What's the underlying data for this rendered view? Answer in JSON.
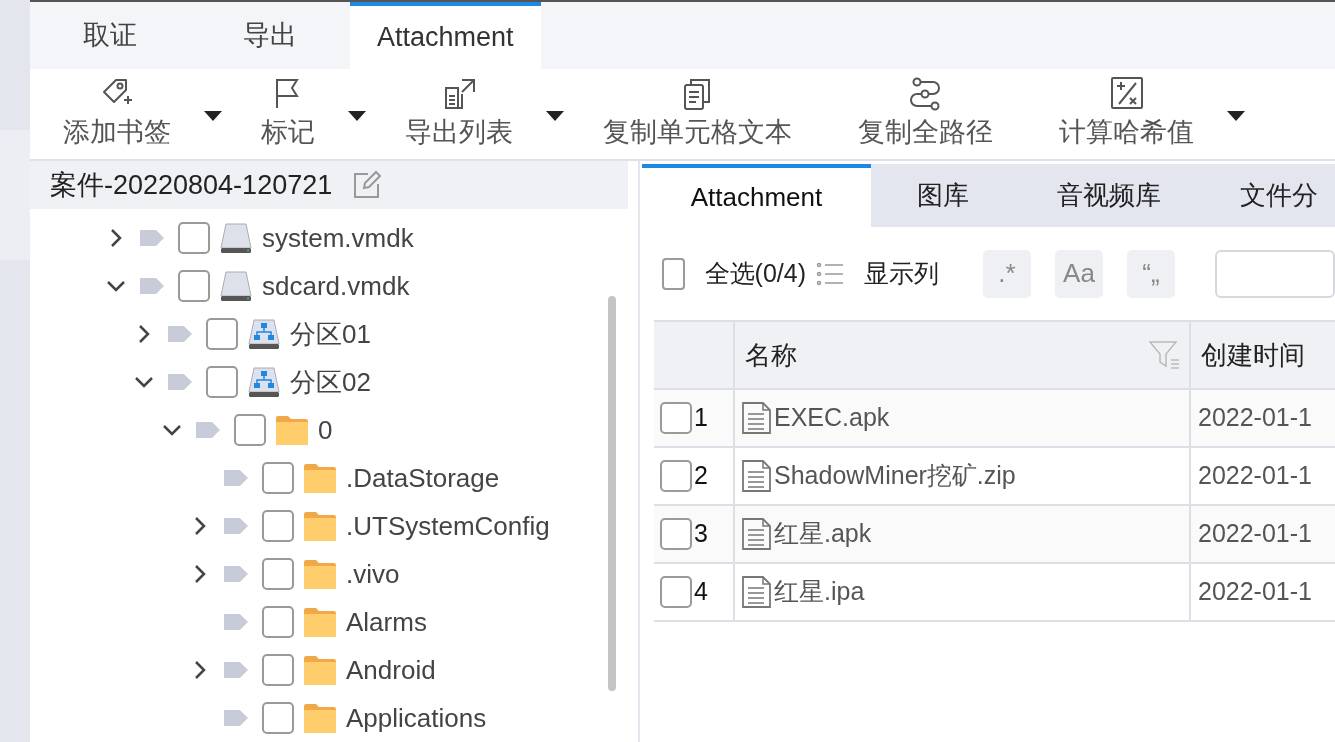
{
  "main_tabs": [
    {
      "label": "取证",
      "selected": false
    },
    {
      "label": "导出",
      "selected": false
    },
    {
      "label": "Attachment",
      "selected": true
    }
  ],
  "toolbar": [
    {
      "kind": "tag",
      "label": "添加书签",
      "dropdown": true
    },
    {
      "kind": "flag",
      "label": "标记",
      "dropdown": true
    },
    {
      "kind": "export",
      "label": "导出列表",
      "dropdown": true
    },
    {
      "kind": "copy",
      "label": "复制单元格文本",
      "dropdown": false
    },
    {
      "kind": "path",
      "label": "复制全路径",
      "dropdown": false
    },
    {
      "kind": "hash",
      "label": "计算哈希值",
      "dropdown": true
    }
  ],
  "case_title": "案件-20220804-120721",
  "tree": [
    {
      "label": "system.vmdk",
      "kind": "disk",
      "expandable": true,
      "expanded": false,
      "checked": false
    },
    {
      "label": "sdcard.vmdk",
      "kind": "disk",
      "expandable": true,
      "expanded": true,
      "checked": false,
      "children": [
        {
          "label": "分区01",
          "kind": "partition",
          "expandable": true,
          "expanded": false,
          "checked": false
        },
        {
          "label": "分区02",
          "kind": "partition",
          "expandable": true,
          "expanded": true,
          "checked": false,
          "children": [
            {
              "label": "0",
              "kind": "folder",
              "expandable": true,
              "expanded": true,
              "checked": false,
              "children": [
                {
                  "label": ".DataStorage",
                  "kind": "folder",
                  "expandable": false,
                  "checked": false
                },
                {
                  "label": ".UTSystemConfig",
                  "kind": "folder",
                  "expandable": true,
                  "expanded": false,
                  "checked": false
                },
                {
                  "label": ".vivo",
                  "kind": "folder",
                  "expandable": true,
                  "expanded": false,
                  "checked": false
                },
                {
                  "label": "Alarms",
                  "kind": "folder",
                  "expandable": false,
                  "checked": false
                },
                {
                  "label": "Android",
                  "kind": "folder",
                  "expandable": true,
                  "expanded": false,
                  "checked": false
                },
                {
                  "label": "Applications",
                  "kind": "folder",
                  "expandable": false,
                  "checked": false
                }
              ]
            }
          ]
        }
      ]
    }
  ],
  "view_tabs": [
    {
      "label": "Attachment",
      "selected": true
    },
    {
      "label": "图库",
      "selected": false
    },
    {
      "label": "音视频库",
      "selected": false
    },
    {
      "label": "文件分",
      "selected": false
    }
  ],
  "select_all": {
    "label": "全选(0/4)",
    "checked": false
  },
  "show_columns": "显示列",
  "search_options": [
    ".*",
    "Aa",
    "“„"
  ],
  "table": {
    "columns": [
      "名称",
      "创建时间"
    ],
    "rows": [
      {
        "index": "1",
        "name": "EXEC.apk",
        "created": "2022-01-1",
        "checked": false
      },
      {
        "index": "2",
        "name": "ShadowMiner挖矿.zip",
        "created": "2022-01-1",
        "checked": false
      },
      {
        "index": "3",
        "name": "红星.apk",
        "created": "2022-01-1",
        "checked": false
      },
      {
        "index": "4",
        "name": "红星.ipa",
        "created": "2022-01-1",
        "checked": false
      }
    ]
  }
}
